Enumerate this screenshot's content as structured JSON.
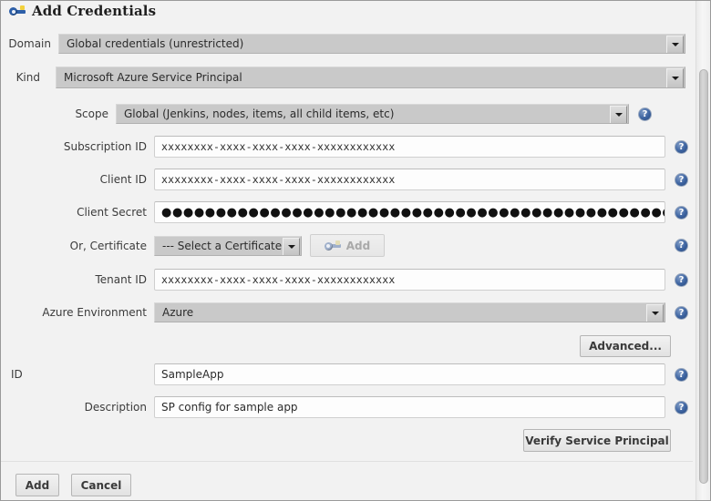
{
  "window": {
    "title": "Add Credentials",
    "title_icon": "key-icon"
  },
  "form": {
    "domain": {
      "label": "Domain",
      "value": "Global credentials (unrestricted)"
    },
    "kind": {
      "label": "Kind",
      "value": "Microsoft Azure Service Principal"
    },
    "scope": {
      "label": "Scope",
      "value": "Global (Jenkins, nodes, items, all child items, etc)"
    },
    "subscription_id": {
      "label": "Subscription ID",
      "value": "xxxxxxxx-xxxx-xxxx-xxxx-xxxxxxxxxxxx"
    },
    "client_id": {
      "label": "Client ID",
      "value": "xxxxxxxx-xxxx-xxxx-xxxx-xxxxxxxxxxxx"
    },
    "client_secret": {
      "label": "Client Secret",
      "value": "●●●●●●●●●●●●●●●●●●●●●●●●●●●●●●●●●●●●●●●●●●●●●●●●●●●●●●●"
    },
    "certificate": {
      "label": "Or, Certificate",
      "value": "--- Select a Certificate ---",
      "add_button": "Add",
      "add_button_icon": "key-icon",
      "add_button_disabled": true
    },
    "tenant_id": {
      "label": "Tenant ID",
      "value": "xxxxxxxx-xxxx-xxxx-xxxx-xxxxxxxxxxxx"
    },
    "azure_environment": {
      "label": "Azure Environment",
      "value": "Azure"
    },
    "advanced_button": "Advanced...",
    "id": {
      "label": "ID",
      "value": "SampleApp"
    },
    "description": {
      "label": "Description",
      "value": "SP config for sample app"
    },
    "verify_button": "Verify Service Principal"
  },
  "help_icon": "?",
  "footer": {
    "add": "Add",
    "cancel": "Cancel"
  },
  "colors": {
    "background": "#f2f2f2",
    "select_background": "#c9c9c9",
    "field_background": "#fdfdfd",
    "help_blue": "#3c63a0",
    "key_blue": "#2d5fa8",
    "key_yellow": "#f2d13c"
  }
}
